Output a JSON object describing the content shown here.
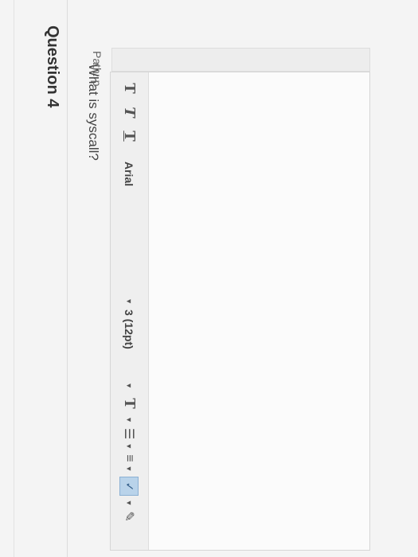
{
  "question": {
    "title": "Question 4",
    "text": "What is syscall?"
  },
  "toolbar": {
    "bold_label": "T",
    "italic_label": "T",
    "underline_label": "T",
    "font_family": "Arial",
    "font_size": "3 (12pt)",
    "text_color_label": "T",
    "icons": [
      "bold-icon",
      "italic-icon",
      "underline-icon",
      "text-color-icon",
      "bullet-list-icon",
      "numbered-list-icon",
      "spellcheck-icon"
    ]
  },
  "statusbar": {
    "path": "Path: p"
  },
  "colors": {
    "accent": "#b9d3ea",
    "background": "#f4f4f4"
  }
}
